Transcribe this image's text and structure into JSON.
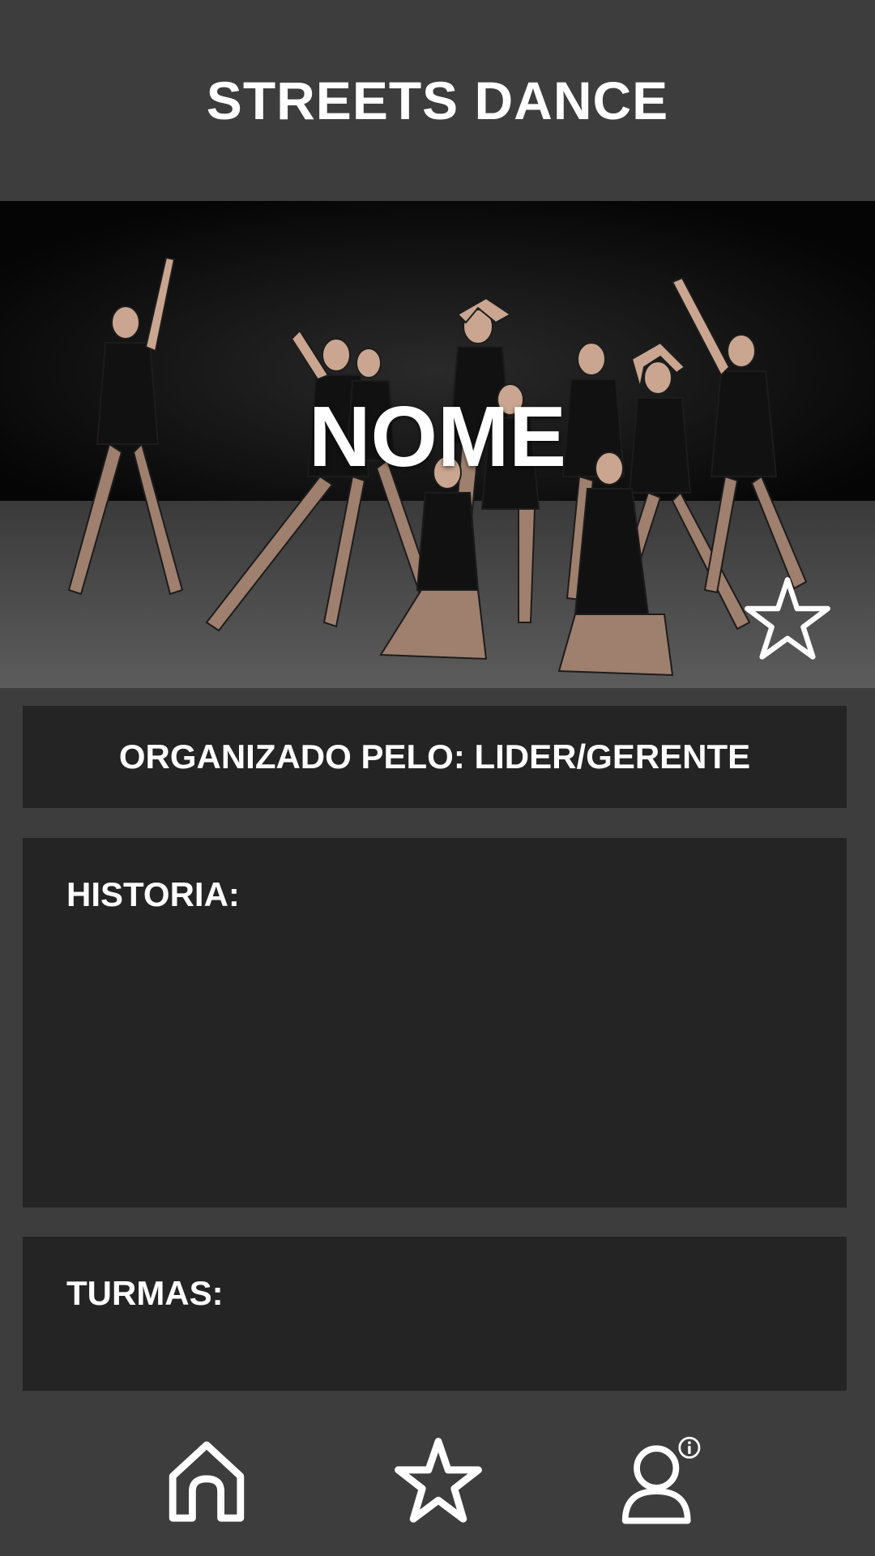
{
  "header": {
    "title": "STREETS DANCE"
  },
  "hero": {
    "name": "NOME",
    "image_alt": "dance-group-photo"
  },
  "organizer": {
    "text": "ORGANIZADO PELO: LIDER/GERENTE"
  },
  "history": {
    "label": "HISTORIA:"
  },
  "classes": {
    "label": "TURMAS:"
  },
  "icons": {
    "favorite": "star-outline-icon",
    "home": "home-icon",
    "favorites_nav": "star-icon",
    "profile": "user-info-icon"
  },
  "colors": {
    "background": "#3d3d3d",
    "card": "#242424",
    "text": "#ffffff"
  }
}
